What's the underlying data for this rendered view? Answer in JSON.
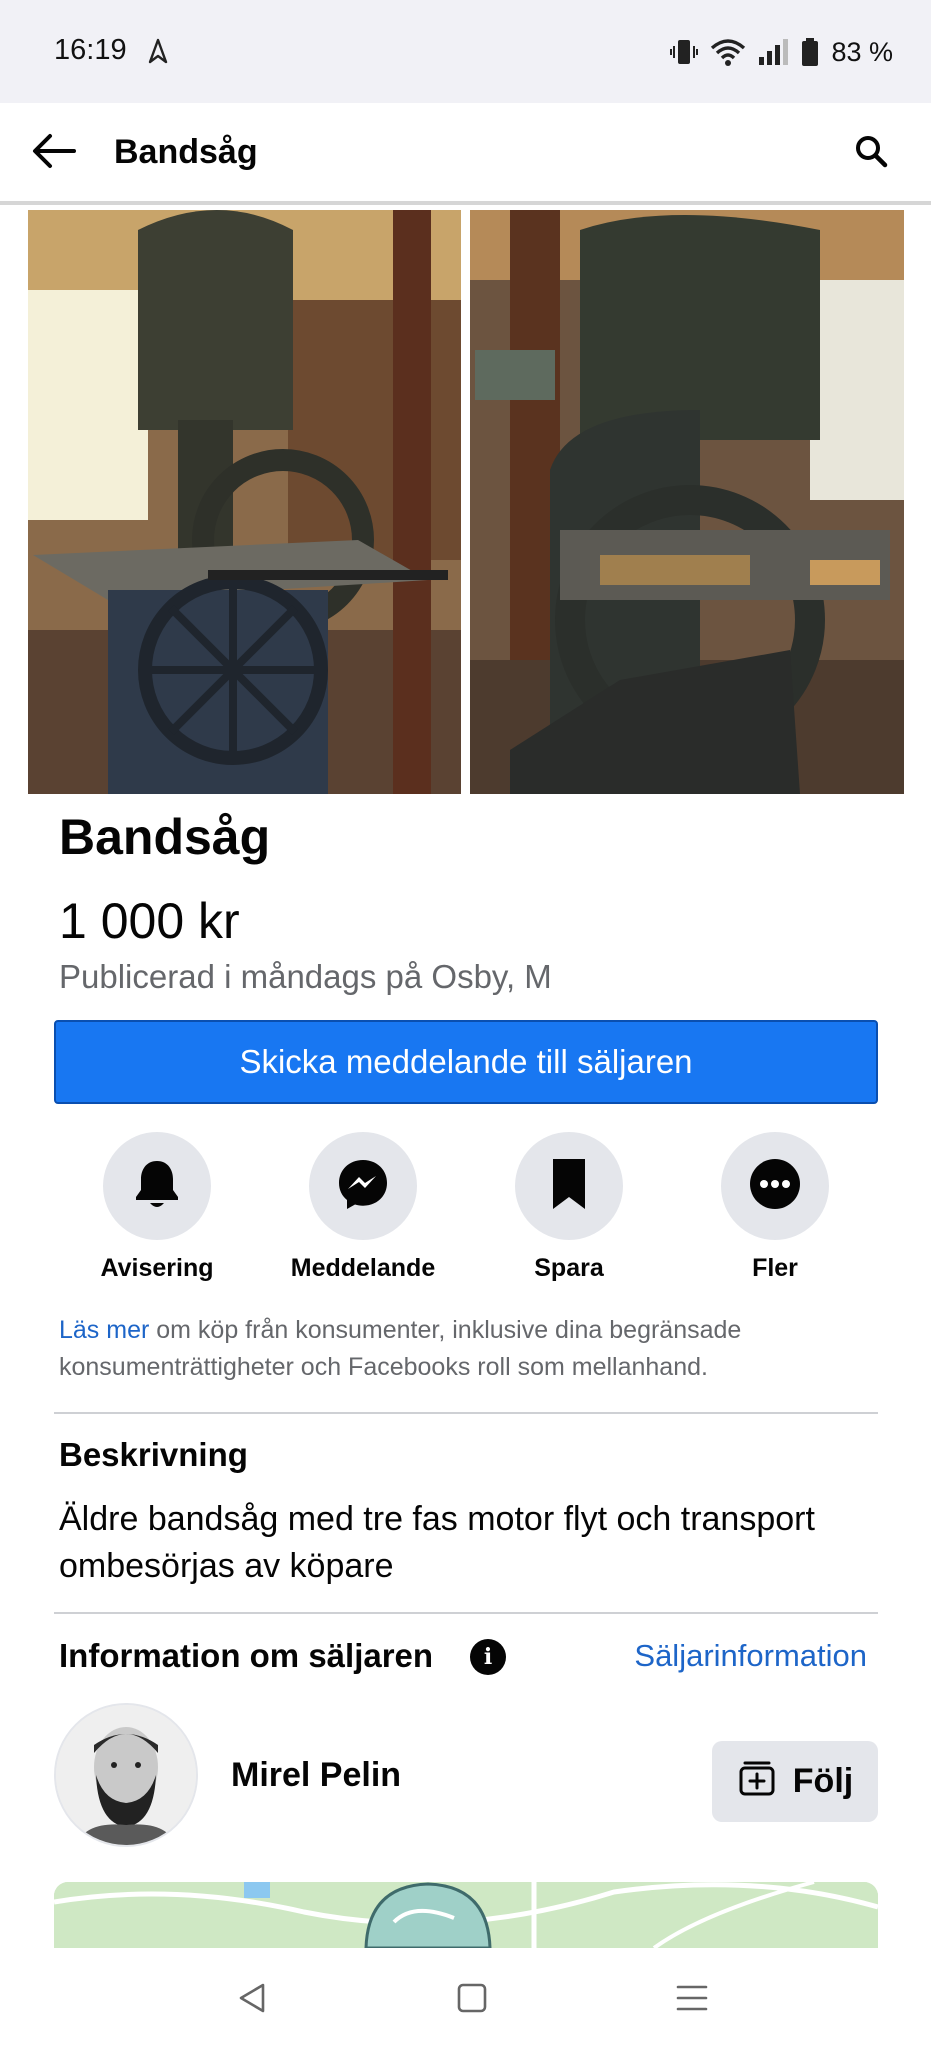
{
  "status_bar": {
    "time": "16:19",
    "battery_percent": "83 %",
    "icons": [
      "navigation-arrow-icon",
      "vibrate-icon",
      "wifi-icon",
      "signal-icon",
      "battery-icon"
    ]
  },
  "app_bar": {
    "title": "Bandsåg",
    "back_icon": "arrow-left-icon",
    "search_icon": "search-icon"
  },
  "listing": {
    "title": "Bandsåg",
    "price": "1 000 kr",
    "meta": "Publicerad i måndags på Osby, M",
    "cta_label": "Skicka meddelande till säljaren"
  },
  "actions": [
    {
      "label": "Avisering",
      "icon": "bell-icon"
    },
    {
      "label": "Meddelande",
      "icon": "messenger-icon"
    },
    {
      "label": "Spara",
      "icon": "bookmark-icon"
    },
    {
      "label": "Fler",
      "icon": "more-icon"
    }
  ],
  "consumer_info": {
    "link_text": "Läs mer",
    "text": " om köp från konsumenter, inklusive dina begränsade konsumenträttigheter och Facebooks roll som mellanhand."
  },
  "description": {
    "heading": "Beskrivning",
    "text": "Äldre bandsåg med tre fas motor flyt och transport ombesörjas av köpare"
  },
  "seller": {
    "heading": "Information om säljaren",
    "info_link": "Säljarinformation",
    "name": "Mirel Pelin",
    "follow_label": "Följ"
  },
  "colors": {
    "accent": "#1877f2",
    "link": "#1d65c8",
    "secondary_text": "#65676b",
    "chip_bg": "#e4e6eb"
  }
}
